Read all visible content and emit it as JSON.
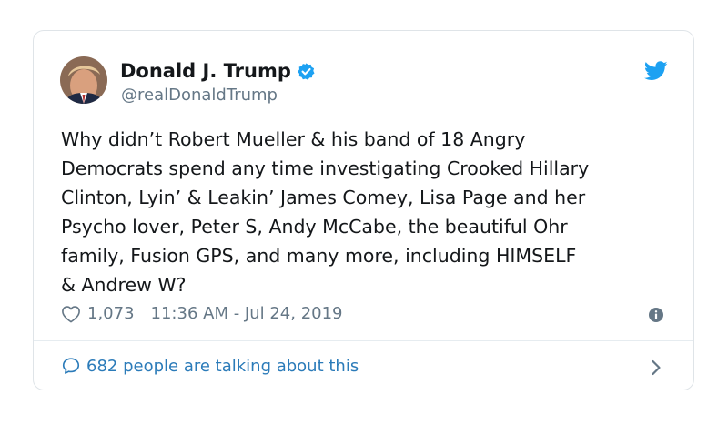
{
  "tweet": {
    "author_name": "Donald J. Trump",
    "author_handle": "@realDonaldTrump",
    "verified": true,
    "text": "Why didn’t Robert Mueller & his band of 18 Angry\nDemocrats spend any time investigating Crooked Hillary\nClinton, Lyin’ & Leakin’ James Comey, Lisa Page and her\nPsycho lover, Peter S, Andy McCabe, the beautiful Ohr\nfamily, Fusion GPS, and many more,  including HIMSELF\n& Andrew W?",
    "likes": "1,073",
    "timestamp": "11:36 AM - Jul 24, 2019",
    "talking_text": "682 people are talking about this"
  },
  "colors": {
    "brand_blue": "#1da1f2",
    "link_blue": "#2b7bb9",
    "text_primary": "#14171a",
    "text_secondary": "#657786",
    "border": "#dfe4e8"
  },
  "icons": {
    "logo": "twitter-bird-icon",
    "verified": "verified-badge-icon",
    "like": "heart-outline-icon",
    "info": "info-icon",
    "replies": "speech-bubble-icon",
    "more": "chevron-right-icon"
  }
}
